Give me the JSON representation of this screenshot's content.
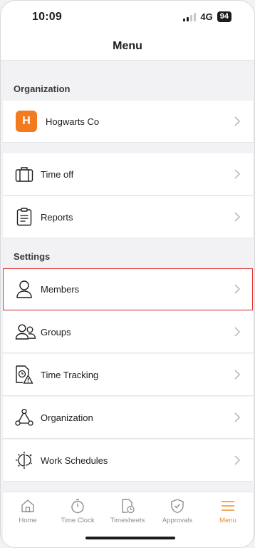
{
  "status": {
    "time": "10:09",
    "network": "4G",
    "battery": "94"
  },
  "nav": {
    "title": "Menu"
  },
  "sections": {
    "organization": "Organization",
    "settings": "Settings"
  },
  "rows": {
    "org": {
      "badge": "H",
      "label": "Hogwarts Co",
      "icon": "org-badge"
    },
    "time_off": {
      "label": "Time off",
      "icon": "suitcase-icon"
    },
    "reports": {
      "label": "Reports",
      "icon": "clipboard-icon"
    },
    "members": {
      "label": "Members",
      "icon": "person-icon"
    },
    "groups": {
      "label": "Groups",
      "icon": "people-icon"
    },
    "time_tracking": {
      "label": "Time Tracking",
      "icon": "file-clock-warning-icon"
    },
    "organization_setting": {
      "label": "Organization",
      "icon": "network-triangle-icon"
    },
    "work_schedules": {
      "label": "Work Schedules",
      "icon": "day-night-icon"
    }
  },
  "tabbar": {
    "home": "Home",
    "time_clock": "Time Clock",
    "timesheets": "Timesheets",
    "approvals": "Approvals",
    "menu": "Menu"
  },
  "colors": {
    "accent": "#f08a24",
    "org_badge": "#f37a1f",
    "highlight": "#e0342f"
  }
}
